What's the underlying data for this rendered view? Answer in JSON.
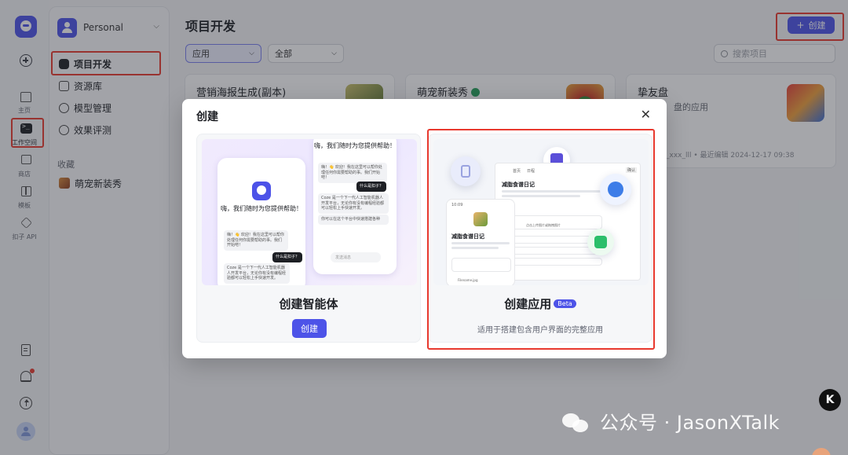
{
  "rail": {
    "home_label": "主页",
    "workspace_label": "工作空间",
    "store_label": "商店",
    "template_label": "模板",
    "api_label": "扣子 API"
  },
  "sidebar": {
    "workspace_name": "Personal",
    "items": [
      {
        "label": "项目开发",
        "active": true
      },
      {
        "label": "资源库"
      },
      {
        "label": "模型管理"
      },
      {
        "label": "效果评测"
      }
    ],
    "favorites_title": "收藏",
    "favorites": [
      {
        "label": "萌宠新装秀"
      }
    ]
  },
  "main": {
    "title": "项目开发",
    "create_label": "创建",
    "filter_type": "应用",
    "filter_scope": "全部",
    "search_placeholder": "搜索项目",
    "cards": [
      {
        "title": "营销海报生成(副本)",
        "desc": "",
        "meta": ""
      },
      {
        "title": "萌宠新装秀",
        "desc": "",
        "meta": ""
      },
      {
        "title": "挚友盘",
        "desc": "盘的应用",
        "meta": "_xxx_lll • 最近编辑 2024-12-17 09:38"
      }
    ]
  },
  "modal": {
    "title": "创建",
    "close": "✕",
    "agent": {
      "title": "创建智能体",
      "button": "创建",
      "mock_header": "嗨，我们随时为您提供帮助！",
      "mock_greeting": "嗨，我们随时为您提供帮助！",
      "mock_msg1": "嗨！👋 欢迎！我在这里可以帮你处理任何你需要帮助的事。我们开始吧！",
      "mock_msg2": "Coze 是一个下一代人工智能机器人开发平台，无论你有没有编程经验都可以轻松上手快速开发。",
      "mock_msg3": "你可以在这个平台中快速搭建各种",
      "mock_chip": "什么是扣子？",
      "mock_input": "发送消息"
    },
    "app": {
      "title": "创建应用",
      "beta": "Beta",
      "subtitle": "适用于搭建包含用户界面的完整应用",
      "mock_title": "减脂食谱日记",
      "mock_time": "10:09",
      "mock_nav1": "首页",
      "mock_nav2": "日程",
      "mock_btn": "确认",
      "mock_upload": "点击上传图片或拖拽图片",
      "mock_file1": "Filename.jpg",
      "mock_file2": "File name.jpg"
    }
  },
  "watermark": "公众号 · JasonXTalk",
  "badge": "K"
}
